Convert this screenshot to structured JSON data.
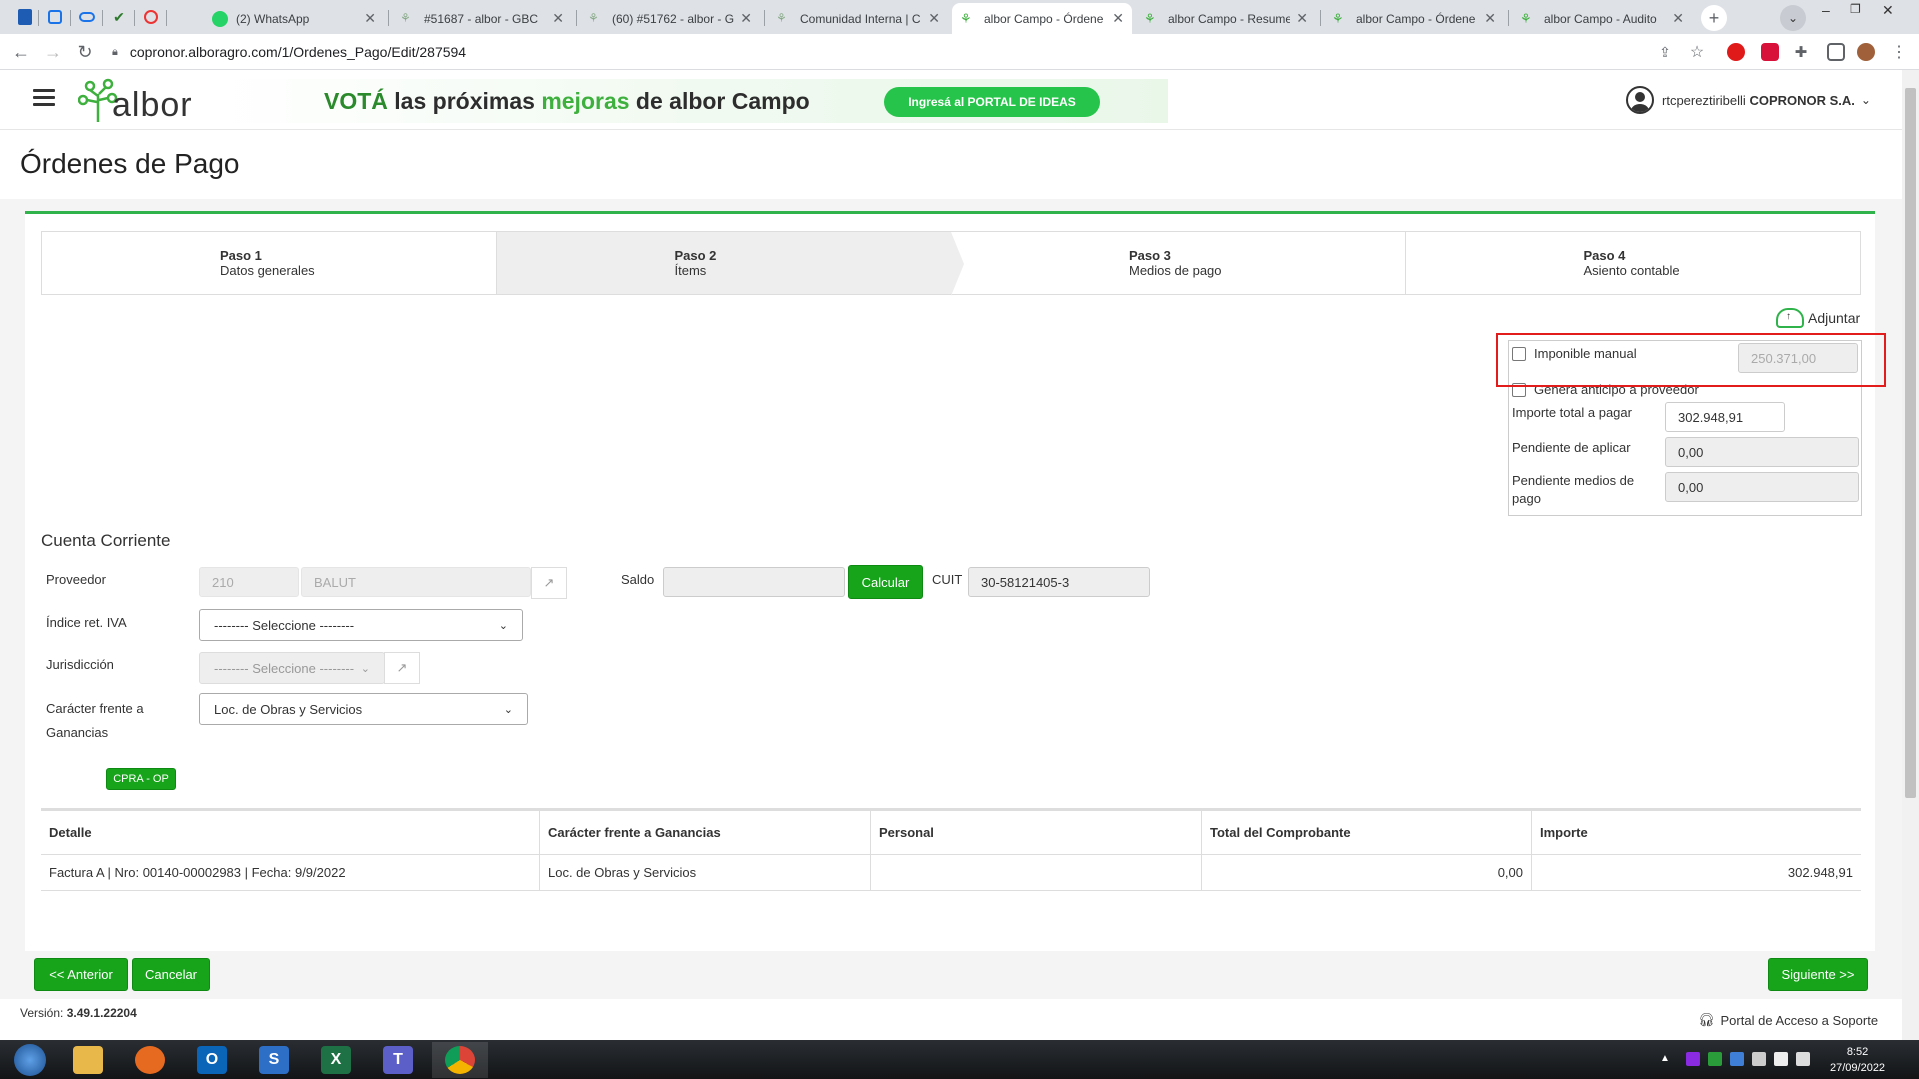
{
  "browser": {
    "tabs": [
      {
        "title": "(2) WhatsApp",
        "active": false
      },
      {
        "title": "#51687 - albor - GBC",
        "active": false
      },
      {
        "title": "(60) #51762 - albor - G",
        "active": false
      },
      {
        "title": "Comunidad Interna | C",
        "active": false
      },
      {
        "title": "albor Campo - Órdene",
        "active": true
      },
      {
        "title": "albor Campo - Resume",
        "active": false
      },
      {
        "title": "albor Campo - Órdene",
        "active": false
      },
      {
        "title": "albor Campo - Audito",
        "active": false
      }
    ],
    "url": "copronor.alboragro.com/1/Ordenes_Pago/Edit/287594"
  },
  "header": {
    "logo_text": "albor",
    "banner": {
      "part1": "VOTÁ",
      "part2": " las próximas ",
      "part3": "mejoras",
      "part4": " de albor Campo",
      "cta": "Ingresá al PORTAL DE IDEAS"
    },
    "user_name": "rtcpereztiribelli",
    "company": "COPRONOR S.A."
  },
  "page": {
    "title": "Órdenes de Pago",
    "steps": [
      {
        "label": "Paso 1",
        "sub": "Datos generales"
      },
      {
        "label": "Paso 2",
        "sub": "Ítems"
      },
      {
        "label": "Paso 3",
        "sub": "Medios de pago"
      },
      {
        "label": "Paso 4",
        "sub": "Asiento contable"
      }
    ],
    "adjuntar": "Adjuntar",
    "summary": {
      "imponible_label": "Imponible manual",
      "imponible_value": "250.371,00",
      "anticipo_label": "Genera anticipo a proveedor",
      "total_label": "Importe total a pagar",
      "total_value": "302.948,91",
      "pend_aplicar_label": "Pendiente de aplicar",
      "pend_aplicar_value": "0,00",
      "pend_medios_label": "Pendiente medios de pago",
      "pend_medios_value": "0,00"
    },
    "cuenta": {
      "section_title": "Cuenta Corriente",
      "proveedor_label": "Proveedor",
      "proveedor_code": "210",
      "proveedor_name": "BALUT",
      "saldo_label": "Saldo",
      "saldo_value": "",
      "calcular": "Calcular",
      "cuit_label": "CUIT",
      "cuit_value": "30-58121405-3",
      "indice_label": "Índice ret. IVA",
      "indice_value": "-------- Seleccione --------",
      "jurisdiccion_label": "Jurisdicción",
      "jurisdiccion_value": "-------- Seleccione --------",
      "caracter_label": "Carácter frente a Ganancias",
      "caracter_value": "Loc. de Obras y Servicios",
      "badge": "CPRA - OP"
    },
    "table": {
      "headers": [
        "Detalle",
        "Carácter frente a Ganancias",
        "Personal",
        "Total del Comprobante",
        "Importe"
      ],
      "rows": [
        [
          "Factura A | Nro: 00140-00002983 | Fecha: 9/9/2022",
          "Loc. de Obras y Servicios",
          "",
          "0,00",
          "302.948,91"
        ]
      ]
    },
    "buttons": {
      "prev": "<< Anterior",
      "cancel": "Cancelar",
      "next": "Siguiente >>"
    },
    "version_label": "Versión:",
    "version": "3.49.1.22204",
    "support": "Portal de Acceso a Soporte"
  },
  "taskbar": {
    "time": "8:52",
    "date": "27/09/2022"
  },
  "colors": {
    "brand_green": "#2fb34a",
    "button_green": "#17a41b",
    "highlight_red": "#e21b1b"
  }
}
